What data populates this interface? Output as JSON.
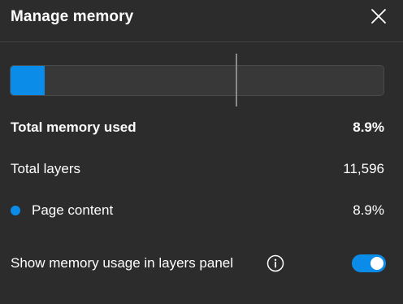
{
  "header": {
    "title": "Manage memory",
    "close_icon": "close-icon"
  },
  "memory_bar": {
    "used_fraction": 0.089,
    "fill_color": "#0c8ce9"
  },
  "stats": {
    "total_memory_label": "Total memory used",
    "total_memory_value": "8.9%",
    "total_layers_label": "Total layers",
    "total_layers_value": "11,596",
    "page_content_label": "Page content",
    "page_content_value": "8.9%"
  },
  "settings": {
    "show_usage_label": "Show memory usage in layers panel",
    "info_icon": "info-icon",
    "show_usage_enabled": true
  },
  "colors": {
    "accent": "#0c8ce9",
    "background": "#2c2c2c"
  }
}
